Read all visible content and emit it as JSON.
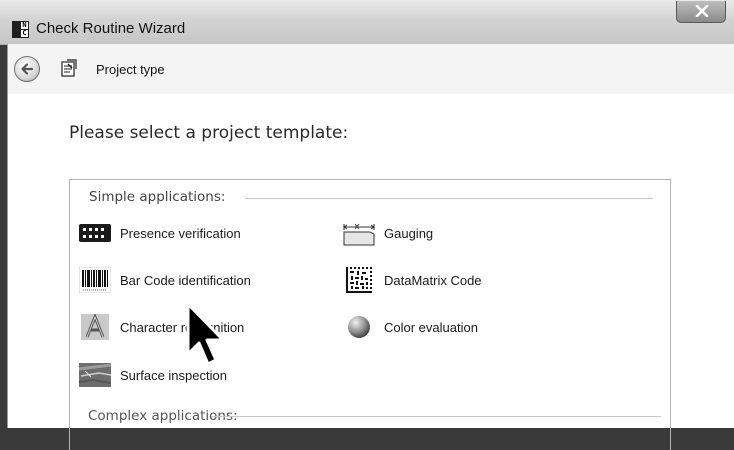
{
  "window": {
    "title": "Check Routine Wizard",
    "app_icon_letters": [
      "N",
      "C"
    ]
  },
  "nav": {
    "title": "Project type"
  },
  "main": {
    "heading": "Please select a project template:",
    "simple_group": {
      "legend": "Simple applications:",
      "items": [
        {
          "label": "Presence verification",
          "icon": "presence-icon"
        },
        {
          "label": "Gauging",
          "icon": "gauging-icon"
        },
        {
          "label": "Bar Code identification",
          "icon": "barcode-icon"
        },
        {
          "label": "DataMatrix Code",
          "icon": "datamatrix-icon"
        },
        {
          "label": "Character recognition",
          "icon": "character-icon"
        },
        {
          "label": "Color evaluation",
          "icon": "color-icon"
        },
        {
          "label": "Surface inspection",
          "icon": "surface-icon"
        }
      ]
    },
    "complex_group": {
      "legend": "Complex applications:"
    }
  }
}
